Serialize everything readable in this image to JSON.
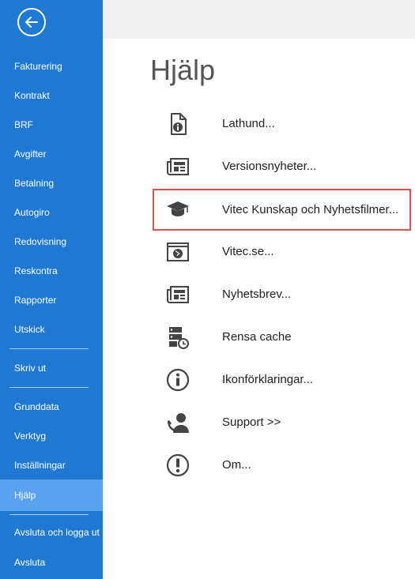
{
  "sidebar": {
    "items": [
      {
        "label": "Fakturering"
      },
      {
        "label": "Kontrakt"
      },
      {
        "label": "BRF"
      },
      {
        "label": "Avgifter"
      },
      {
        "label": "Betalning"
      },
      {
        "label": "Autogiro"
      },
      {
        "label": "Redovisning"
      },
      {
        "label": "Reskontra"
      },
      {
        "label": "Rapporter"
      },
      {
        "label": "Utskick"
      },
      {
        "label": "Skriv ut"
      },
      {
        "label": "Grunddata"
      },
      {
        "label": "Verktyg"
      },
      {
        "label": "Inställningar"
      },
      {
        "label": "Hjälp"
      },
      {
        "label": "Avsluta och logga ut"
      },
      {
        "label": "Avsluta"
      }
    ],
    "active_item": "Hjälp"
  },
  "main": {
    "title": "Hjälp",
    "items": [
      {
        "label": "Lathund...",
        "icon": "document-info-icon"
      },
      {
        "label": "Versionsnyheter...",
        "icon": "newspaper-icon"
      },
      {
        "label": "Vitec Kunskap och Nyhetsfilmer...",
        "icon": "graduation-cap-icon"
      },
      {
        "label": "Vitec.se...",
        "icon": "globe-window-icon"
      },
      {
        "label": "Nyhetsbrev...",
        "icon": "newspaper-icon"
      },
      {
        "label": "Rensa cache",
        "icon": "server-clock-icon"
      },
      {
        "label": "Ikonförklaringar...",
        "icon": "info-circle-icon"
      },
      {
        "label": "Support >>",
        "icon": "support-phone-user-icon"
      },
      {
        "label": "Om...",
        "icon": "exclamation-circle-icon"
      }
    ]
  },
  "colors": {
    "sidebar_bg": "#1f79d3",
    "sidebar_active": "#5aa2f0",
    "highlight_border": "#d9534f",
    "icon": "#444444"
  }
}
